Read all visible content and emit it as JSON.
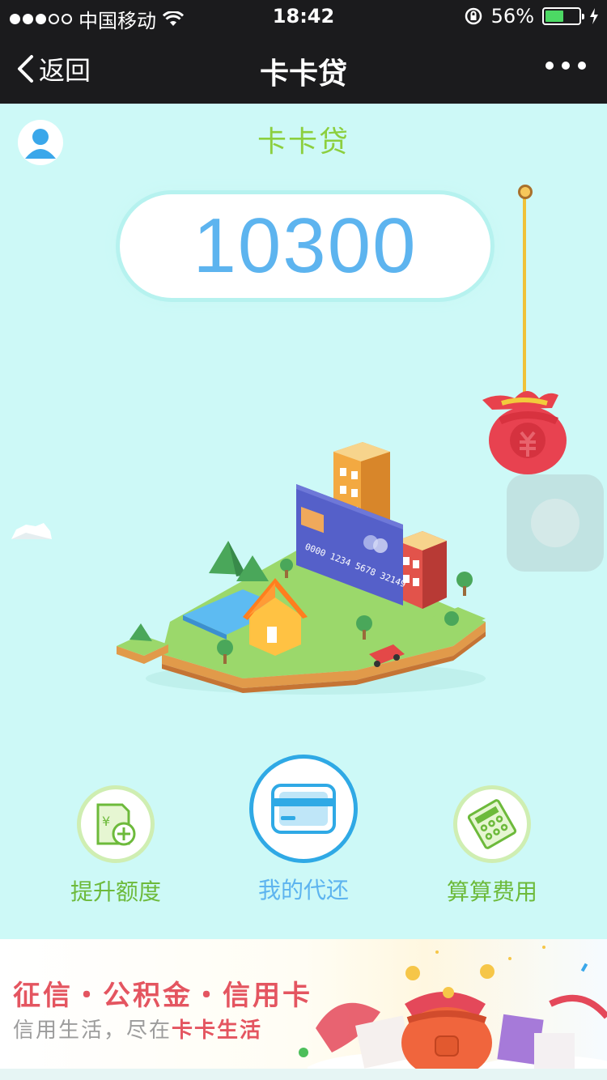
{
  "status_bar": {
    "carrier": "中国移动",
    "time": "18:42",
    "battery": "56%",
    "battery_level": 0.56
  },
  "nav": {
    "back_label": "返回",
    "title": "卡卡贷"
  },
  "page": {
    "title": "卡卡贷",
    "amount": "10300"
  },
  "illustration": {
    "card_number": "0000 1234 5678 32149"
  },
  "actions": [
    {
      "label": "提升额度",
      "icon": "raise-limit-icon"
    },
    {
      "label": "我的代还",
      "icon": "credit-card-icon"
    },
    {
      "label": "算算费用",
      "icon": "calculate-fee-icon"
    }
  ],
  "banner": {
    "headline": "征信・公积金・信用卡",
    "sub_prefix": "信用生活，尽在",
    "sub_highlight": "卡卡生活"
  },
  "colors": {
    "background": "#cdf9f7",
    "green": "#8ccf3e",
    "blue": "#5db4ef",
    "red": "#e45560"
  }
}
